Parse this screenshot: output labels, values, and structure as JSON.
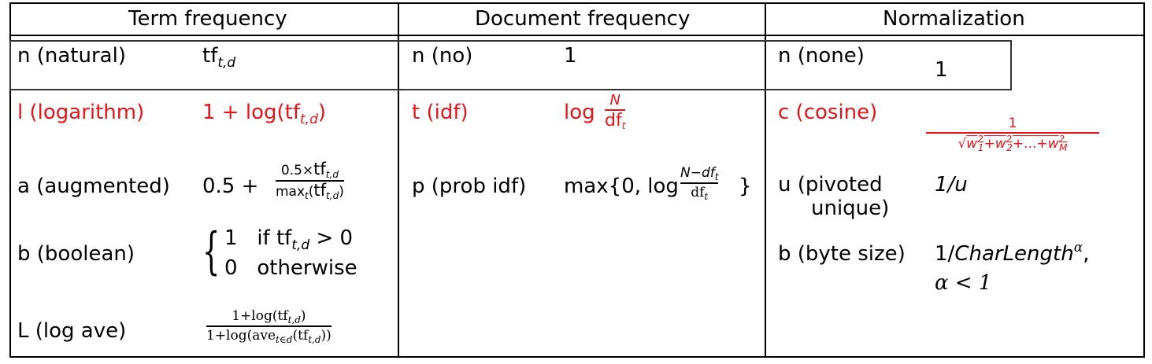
{
  "headers": {
    "term": "Term frequency",
    "doc": "Document frequency",
    "norm": "Normalization"
  },
  "term_frequency": {
    "n_label": "n (natural)",
    "l_label": "l (logarithm)",
    "l_formula_prefix": "1 + log(",
    "l_formula_suffix": ")",
    "a_label": "a (augmented)",
    "a_formula_prefix": "0.5 +",
    "a_num": "0.5×",
    "a_den_prefix": "max",
    "b_label": "b (boolean)",
    "b_case1_value": "1",
    "b_case1_cond": "if tf",
    "b_case1_cmp": " > 0",
    "b_case2_value": "0",
    "b_case2_cond": "otherwise",
    "L_label": "L (log ave)",
    "L_num": "1+log(tf",
    "L_den": "1+log(ave",
    "tf": "tf",
    "td": "t,d",
    "t": "t",
    "tind": "t∈d"
  },
  "document_frequency": {
    "n_label": "n (no)",
    "n_formula": "1",
    "t_label": "t (idf)",
    "t_log": "log",
    "t_num": "N",
    "t_den": "df",
    "p_label": "p (prob idf)",
    "p_prefix": "max{0, log",
    "p_num": "N−df",
    "p_den": "df",
    "p_suffix": "}"
  },
  "normalization": {
    "n_label": "n (none)",
    "n_formula": "1",
    "c_label": "c (cosine)",
    "c_num": "1",
    "c_w": "w",
    "c_plus": "+",
    "c_dots": "+...+",
    "u_label_line1": "u (pivoted",
    "u_label_line2": "unique)",
    "u_formula": "1/u",
    "b_label": "b (byte size)",
    "b_formula_prefix": "1/",
    "b_formula_var": "CharLength",
    "b_formula_sup": "α",
    "b_formula_comma": ",",
    "b_cond": "α < 1"
  },
  "colors": {
    "highlight": "#e8141a",
    "text": "#000000"
  }
}
